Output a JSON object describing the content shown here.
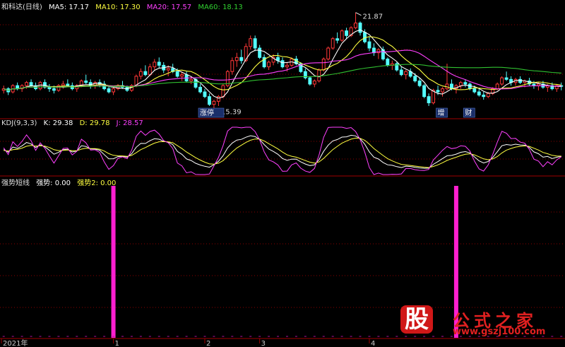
{
  "header_main": {
    "title": "和科达(日线)",
    "ma5": "MA5: 17.17",
    "ma10": "MA10: 17.30",
    "ma20": "MA20: 17.57",
    "ma60": "MA60: 18.13"
  },
  "header_kdj": {
    "title": "KDJ(9,3,3)",
    "k": "K: 29.38",
    "d": "D: 29.78",
    "j": "J: 28.57"
  },
  "header_ind": {
    "title": "强势短线",
    "s1": "强势: 0.00",
    "s2": "强势2: 0.00"
  },
  "colors": {
    "up": "#ff3838",
    "down": "#54ffff",
    "ma5": "#ffffff",
    "ma10": "#ffff40",
    "ma20": "#ff40ff",
    "ma60": "#30c030",
    "grid": "#8b0000",
    "signal": "#ff1fd0"
  },
  "watermark": {
    "logo_char": "股",
    "title": "公式之家",
    "url": "www.gszj100.com"
  },
  "chart_data": [
    {
      "type": "candlestick",
      "title": "和科达(日线)",
      "series": [
        "MA5",
        "MA10",
        "MA20",
        "MA60"
      ],
      "annotations": [
        {
          "label": "21.87",
          "type": "high"
        },
        {
          "label": "15.39",
          "type": "low"
        },
        {
          "label": "涨停",
          "type": "marker"
        },
        {
          "label": "增",
          "type": "marker"
        },
        {
          "label": "财",
          "type": "marker"
        }
      ],
      "ohlc": [
        [
          16.9,
          17.2,
          16.7,
          17.0
        ],
        [
          17.0,
          17.1,
          16.6,
          16.8
        ],
        [
          16.8,
          17.3,
          16.7,
          17.2
        ],
        [
          17.2,
          17.4,
          16.9,
          17.0
        ],
        [
          17.0,
          17.3,
          16.8,
          17.2
        ],
        [
          17.2,
          17.5,
          17.0,
          17.4
        ],
        [
          17.4,
          17.6,
          17.1,
          17.2
        ],
        [
          17.2,
          17.4,
          16.9,
          17.0
        ],
        [
          17.0,
          17.5,
          16.9,
          17.4
        ],
        [
          17.4,
          17.6,
          17.0,
          17.1
        ],
        [
          17.1,
          17.3,
          16.8,
          17.0
        ],
        [
          17.0,
          17.2,
          16.7,
          16.9
        ],
        [
          16.9,
          17.3,
          16.8,
          17.2
        ],
        [
          17.2,
          17.5,
          17.0,
          17.3
        ],
        [
          17.3,
          17.6,
          17.1,
          17.2
        ],
        [
          17.2,
          17.4,
          16.9,
          17.0
        ],
        [
          17.0,
          17.3,
          16.8,
          17.2
        ],
        [
          17.2,
          17.6,
          17.1,
          17.5
        ],
        [
          17.5,
          17.9,
          17.3,
          17.4
        ],
        [
          17.4,
          17.6,
          17.0,
          17.2
        ],
        [
          17.2,
          17.5,
          17.0,
          17.4
        ],
        [
          17.4,
          17.6,
          17.1,
          17.3
        ],
        [
          17.3,
          17.5,
          16.9,
          17.0
        ],
        [
          17.0,
          17.2,
          16.7,
          16.8
        ],
        [
          16.8,
          17.1,
          16.6,
          17.0
        ],
        [
          17.0,
          17.3,
          16.9,
          17.2
        ],
        [
          17.2,
          17.5,
          17.0,
          17.1
        ],
        [
          17.1,
          17.2,
          16.8,
          16.9
        ],
        [
          16.9,
          17.3,
          16.8,
          17.2
        ],
        [
          17.2,
          17.9,
          17.1,
          17.8
        ],
        [
          17.8,
          18.3,
          17.6,
          18.1
        ],
        [
          18.1,
          18.5,
          17.8,
          17.9
        ],
        [
          17.9,
          18.6,
          17.8,
          18.4
        ],
        [
          18.4,
          18.9,
          18.2,
          18.7
        ],
        [
          18.7,
          19.0,
          18.3,
          18.5
        ],
        [
          18.5,
          18.7,
          18.0,
          18.2
        ],
        [
          18.2,
          18.5,
          17.8,
          18.3
        ],
        [
          18.3,
          18.6,
          18.0,
          18.1
        ],
        [
          18.1,
          18.3,
          17.7,
          17.8
        ],
        [
          17.8,
          18.1,
          17.5,
          17.9
        ],
        [
          17.9,
          18.1,
          17.4,
          17.5
        ],
        [
          17.5,
          17.8,
          17.3,
          17.6
        ],
        [
          17.6,
          17.7,
          17.0,
          17.1
        ],
        [
          17.1,
          17.3,
          16.7,
          16.8
        ],
        [
          16.8,
          17.0,
          16.4,
          16.5
        ],
        [
          16.5,
          16.7,
          15.9,
          16.0
        ],
        [
          16.0,
          16.3,
          15.39,
          16.2
        ],
        [
          16.2,
          16.6,
          15.9,
          16.5
        ],
        [
          16.5,
          17.3,
          16.4,
          17.2
        ],
        [
          17.2,
          18.2,
          17.1,
          18.1
        ],
        [
          18.1,
          19.0,
          17.9,
          18.8
        ],
        [
          18.8,
          19.3,
          18.4,
          19.0
        ],
        [
          19.0,
          19.5,
          18.6,
          18.8
        ],
        [
          18.8,
          19.9,
          18.7,
          19.7
        ],
        [
          19.7,
          20.4,
          19.5,
          20.2
        ],
        [
          20.2,
          20.4,
          19.4,
          19.6
        ],
        [
          19.6,
          19.8,
          18.9,
          19.0
        ],
        [
          19.0,
          19.2,
          18.3,
          18.4
        ],
        [
          18.4,
          18.8,
          18.2,
          18.7
        ],
        [
          18.7,
          19.2,
          18.5,
          19.0
        ],
        [
          19.0,
          19.3,
          18.6,
          18.8
        ],
        [
          18.8,
          19.0,
          18.3,
          18.4
        ],
        [
          18.4,
          18.7,
          18.1,
          18.5
        ],
        [
          18.5,
          19.0,
          18.4,
          18.9
        ],
        [
          18.9,
          19.1,
          18.5,
          18.6
        ],
        [
          18.6,
          18.7,
          18.0,
          18.1
        ],
        [
          18.1,
          18.3,
          17.6,
          17.7
        ],
        [
          17.7,
          17.8,
          17.2,
          17.3
        ],
        [
          17.3,
          17.6,
          17.1,
          17.5
        ],
        [
          17.5,
          18.3,
          17.4,
          18.2
        ],
        [
          18.2,
          19.0,
          18.1,
          18.9
        ],
        [
          18.9,
          19.7,
          18.8,
          19.6
        ],
        [
          19.6,
          20.3,
          19.5,
          20.2
        ],
        [
          20.2,
          20.6,
          19.9,
          20.1
        ],
        [
          20.1,
          20.8,
          20.0,
          20.7
        ],
        [
          20.7,
          20.9,
          20.2,
          20.4
        ],
        [
          20.4,
          21.0,
          20.3,
          20.9
        ],
        [
          20.9,
          21.87,
          20.8,
          21.2
        ],
        [
          21.2,
          21.3,
          20.4,
          20.6
        ],
        [
          20.6,
          20.8,
          19.9,
          20.0
        ],
        [
          20.0,
          20.3,
          19.4,
          19.6
        ],
        [
          19.6,
          19.9,
          19.1,
          19.3
        ],
        [
          19.3,
          19.6,
          18.9,
          19.5
        ],
        [
          19.5,
          19.7,
          18.8,
          18.9
        ],
        [
          18.9,
          19.0,
          18.4,
          18.5
        ],
        [
          18.5,
          18.8,
          18.2,
          18.6
        ],
        [
          18.6,
          18.7,
          18.1,
          18.2
        ],
        [
          18.2,
          18.4,
          17.8,
          17.9
        ],
        [
          17.9,
          18.2,
          17.6,
          18.1
        ],
        [
          18.1,
          18.3,
          17.7,
          17.8
        ],
        [
          17.8,
          18.0,
          17.4,
          17.5
        ],
        [
          17.5,
          17.7,
          17.1,
          17.2
        ],
        [
          17.2,
          17.3,
          16.4,
          16.5
        ],
        [
          16.5,
          16.7,
          15.9,
          16.1
        ],
        [
          16.1,
          17.0,
          16.0,
          16.9
        ],
        [
          16.9,
          17.2,
          16.6,
          16.8
        ],
        [
          16.8,
          17.1,
          16.5,
          17.0
        ],
        [
          17.0,
          18.6,
          16.9,
          17.3
        ],
        [
          17.3,
          17.6,
          16.9,
          17.0
        ],
        [
          17.0,
          17.3,
          16.7,
          17.2
        ],
        [
          17.2,
          17.5,
          17.0,
          17.4
        ],
        [
          17.4,
          17.6,
          17.1,
          17.3
        ],
        [
          17.3,
          17.4,
          16.9,
          17.0
        ],
        [
          17.0,
          17.2,
          16.7,
          16.8
        ],
        [
          16.8,
          17.0,
          16.5,
          16.6
        ],
        [
          16.6,
          16.8,
          16.3,
          16.5
        ],
        [
          16.5,
          16.8,
          16.4,
          16.7
        ],
        [
          16.7,
          17.1,
          16.6,
          17.0
        ],
        [
          17.0,
          17.4,
          16.9,
          17.3
        ],
        [
          17.3,
          17.8,
          17.2,
          17.7
        ],
        [
          17.7,
          18.1,
          17.5,
          17.6
        ],
        [
          17.6,
          17.8,
          17.2,
          17.4
        ],
        [
          17.4,
          17.7,
          17.2,
          17.6
        ],
        [
          17.6,
          17.8,
          17.3,
          17.4
        ],
        [
          17.4,
          17.6,
          17.1,
          17.5
        ],
        [
          17.5,
          17.7,
          17.2,
          17.3
        ],
        [
          17.3,
          17.5,
          17.0,
          17.2
        ],
        [
          17.2,
          17.4,
          16.9,
          17.3
        ],
        [
          17.3,
          17.5,
          17.0,
          17.1
        ],
        [
          17.1,
          17.3,
          16.8,
          17.2
        ],
        [
          17.2,
          17.4,
          16.9,
          17.0
        ],
        [
          17.0,
          17.3,
          16.8,
          17.2
        ],
        [
          17.2,
          17.4,
          16.9,
          17.17
        ]
      ]
    },
    {
      "type": "line",
      "title": "KDJ(9,3,3)",
      "series_names": [
        "K",
        "D",
        "J"
      ],
      "ylim": [
        -10,
        110
      ],
      "last": {
        "K": 29.38,
        "D": 29.78,
        "J": 28.57
      }
    },
    {
      "type": "bar",
      "title": "强势短线",
      "series_names": [
        "强势",
        "强势2"
      ],
      "signal_index": [
        24,
        99
      ],
      "values_last": {
        "强势": 0.0,
        "强势2": 0.0
      }
    }
  ],
  "x_axis": {
    "labels": [
      {
        "text": "2021年",
        "index": 0
      },
      {
        "text": "1",
        "index": 24
      },
      {
        "text": "2",
        "index": 44
      },
      {
        "text": "3",
        "index": 56
      },
      {
        "text": "4",
        "index": 80
      }
    ]
  }
}
